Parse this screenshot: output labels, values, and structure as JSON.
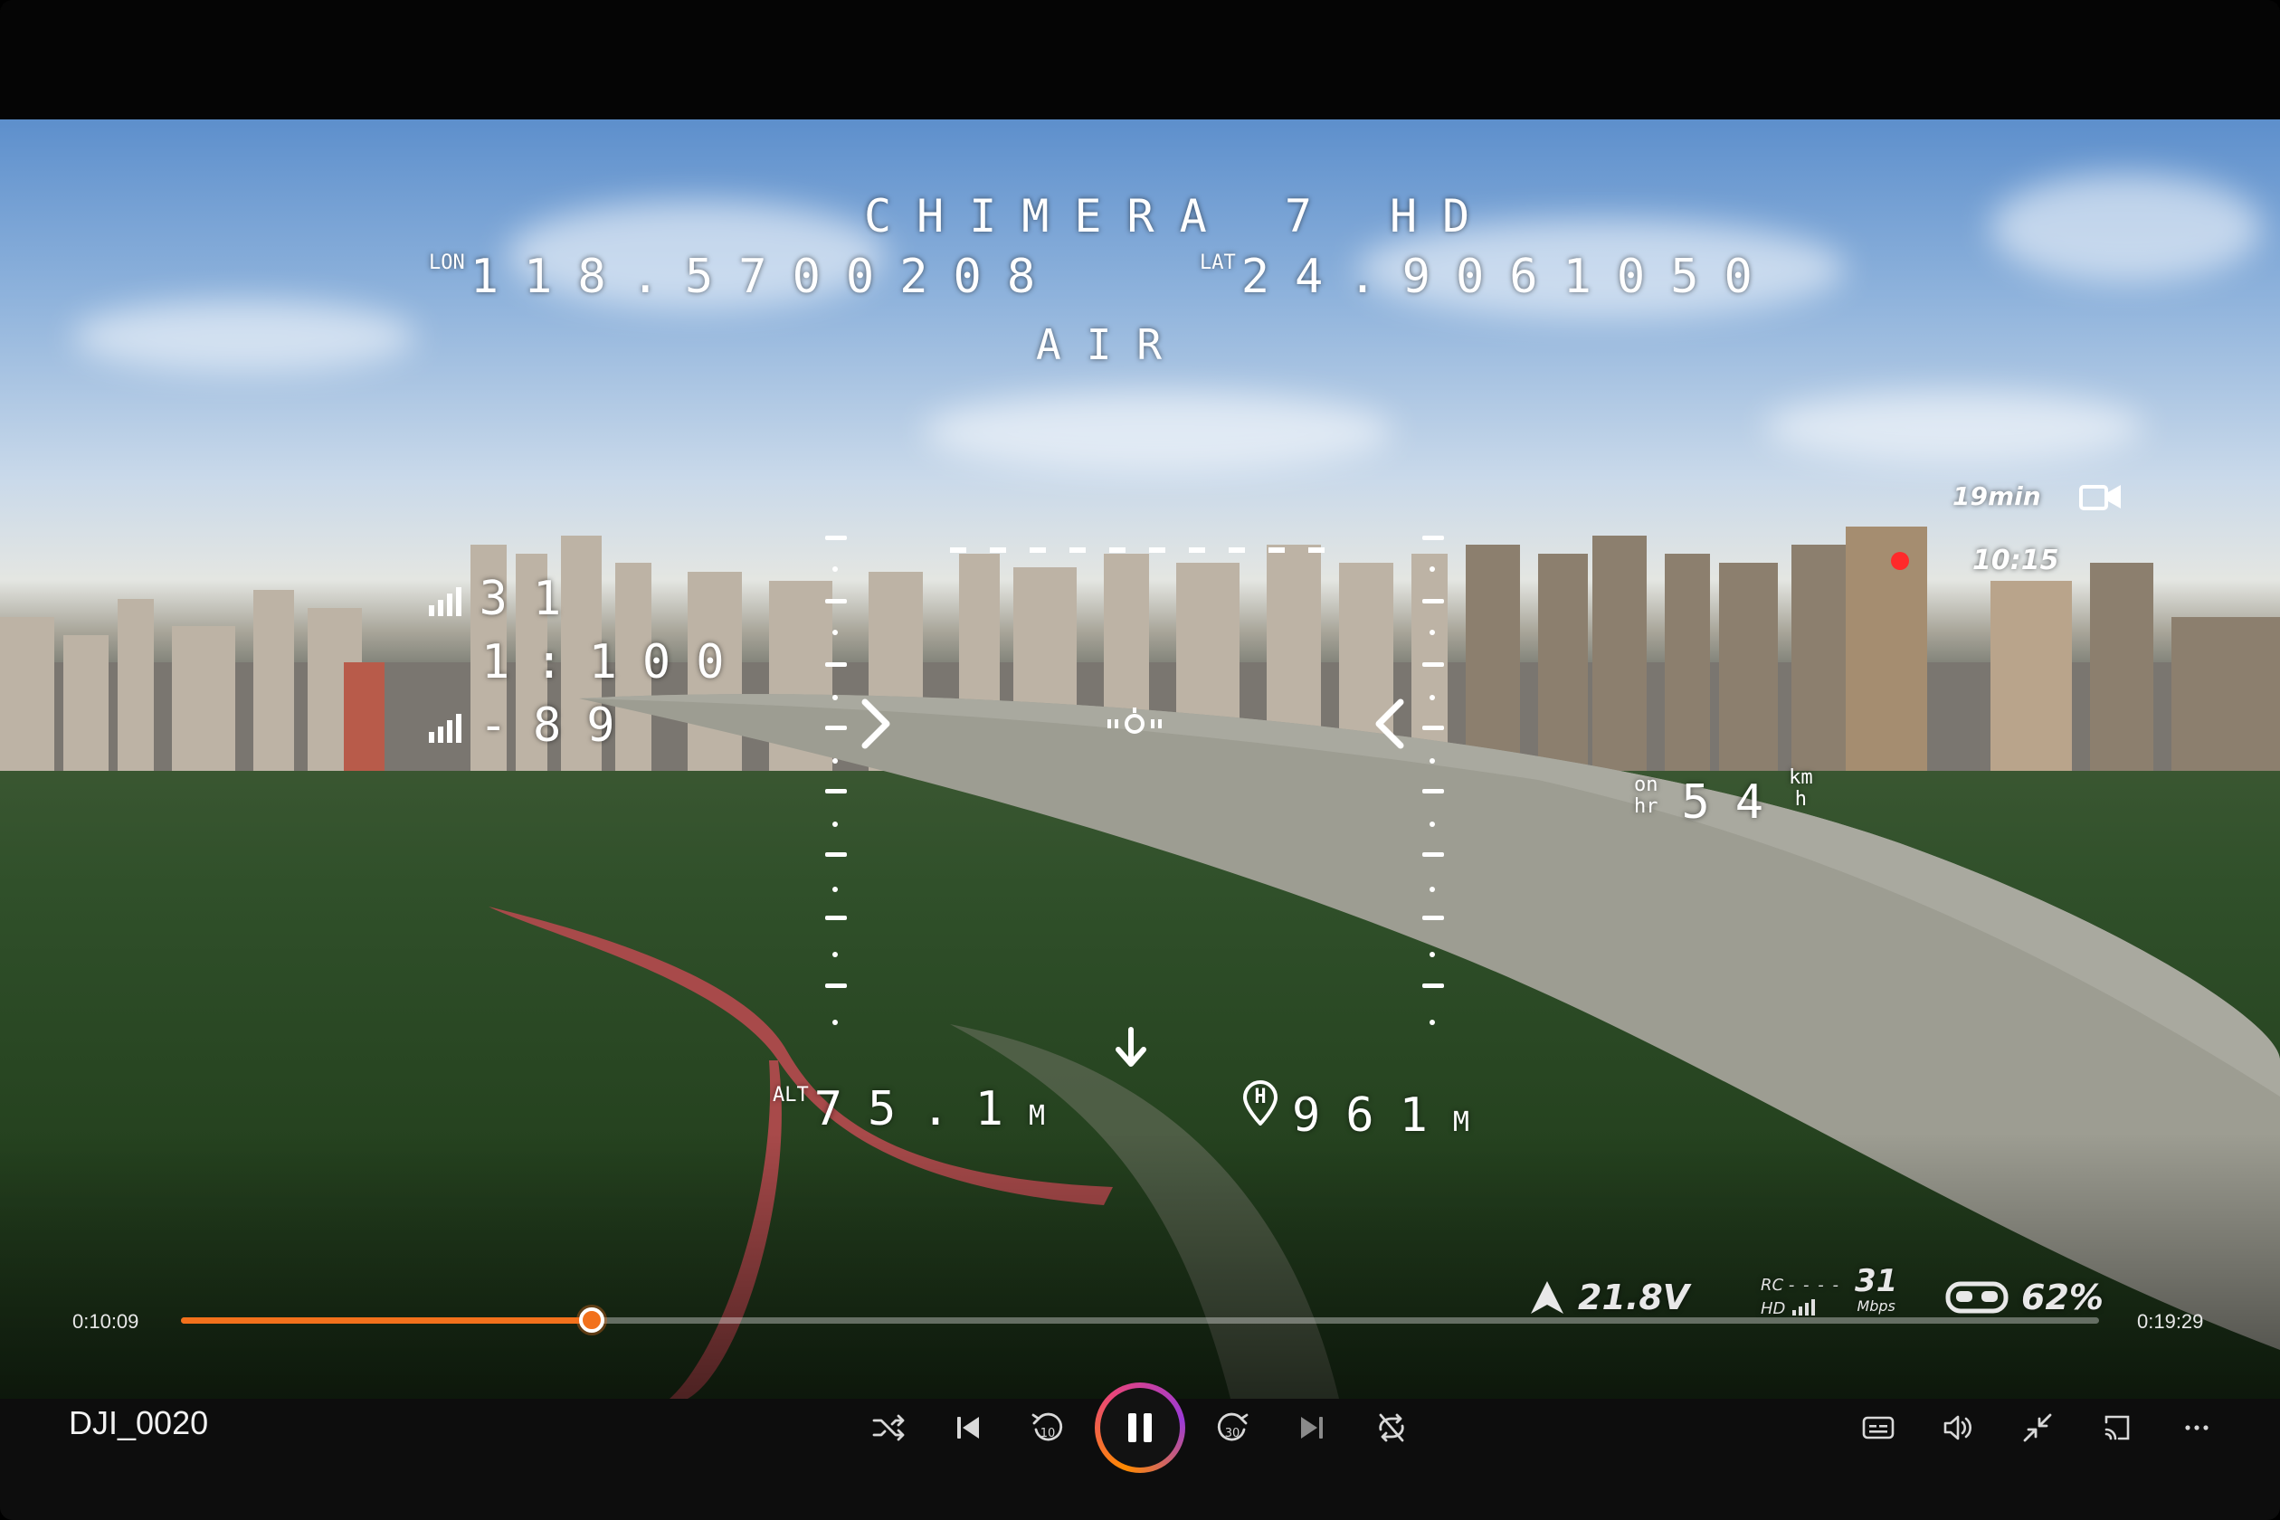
{
  "media": {
    "title": "DJI_0020",
    "elapsed": "0:10:09",
    "duration": "0:19:29",
    "progress_fraction": 0.214
  },
  "osd": {
    "craft_name": "CHIMERA 7 HD",
    "lon_label": "LON",
    "lon_value": "118.5700208",
    "lat_label": "LAT",
    "lat_value": "24.9061050",
    "mode": "AIR",
    "signal_top": "31",
    "ratio": "1:100",
    "signal_bottom": "-89",
    "speed_label_top": "on",
    "speed_label_bottom": "hr",
    "speed_value": "54",
    "speed_unit_top": "km",
    "speed_unit_bottom": "h",
    "alt_label": "ALT",
    "alt_value": "75.1",
    "alt_unit": "M",
    "home_label": "H",
    "home_value": "961",
    "home_unit": "M",
    "rec_remaining": "19min",
    "clock": "10:15",
    "voltage": "21.8V",
    "rc_label": "RC",
    "hd_label": "HD",
    "bitrate_value": "31",
    "bitrate_unit": "Mbps",
    "goggle_battery": "62%"
  },
  "icons": {
    "shuffle": "shuffle-icon",
    "previous": "skip-previous-icon",
    "rewind": "rewind-10-icon",
    "play_pause": "pause-icon",
    "forward": "forward-30-icon",
    "next": "skip-next-icon",
    "repeat": "repeat-off-icon",
    "captions": "captions-icon",
    "volume": "volume-icon",
    "mini": "mini-player-icon",
    "cast": "cast-icon",
    "more": "more-icon"
  },
  "colors": {
    "accent": "#f2711c",
    "rec_dot": "#ff2a2a"
  }
}
